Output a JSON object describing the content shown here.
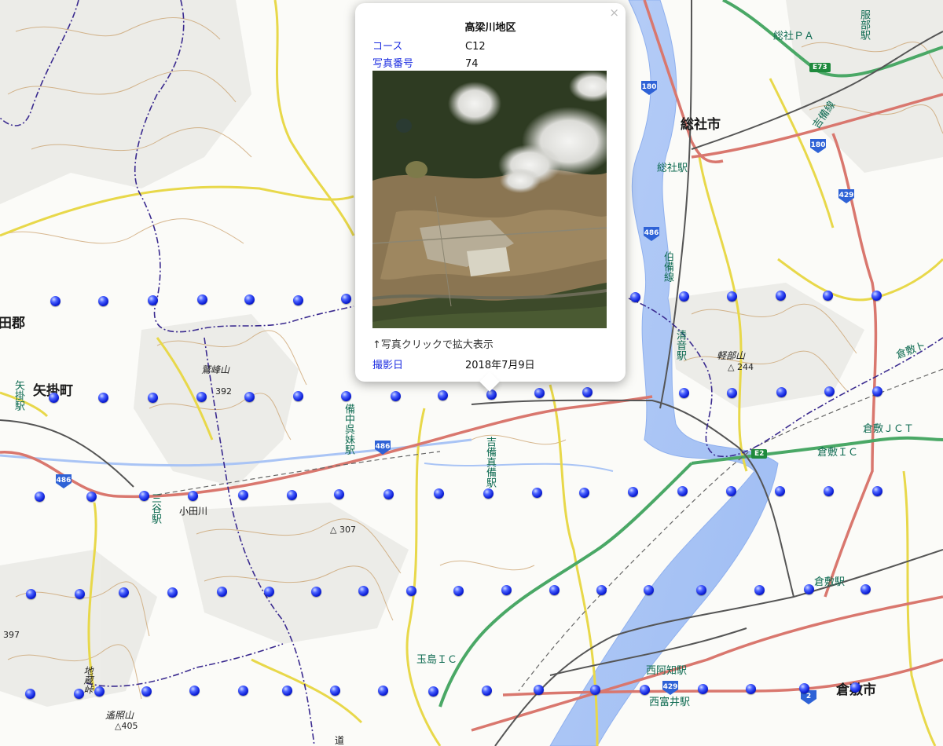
{
  "map": {
    "labels": {
      "sojashi": "総社市",
      "yakagecho": "矢掛町",
      "kurashikishi": "倉敷市",
      "gun": "田郡",
      "soja_station": "総社駅",
      "soja_pa": "総社ＰＡ",
      "hattori_station": "服部駅",
      "kibi_line": "吉備線",
      "hakubi_line": "伯備線",
      "kiyone_station": "清音駅",
      "karube_yama": "軽部山",
      "elev_244": "244",
      "kurashiki_to": "倉敷ト",
      "kurashiki_jct": "倉敷ＪＣＴ",
      "kurashiki_ic": "倉敷ＩＣ",
      "kurashiki_station": "倉敷駅",
      "nishiachi_station": "西阿知駅",
      "nishitomii_station": "西富井駅",
      "tamashima_ic": "玉島ＩＣ",
      "bicchu_kurezuma_station": "備中呉妹駅",
      "kibimakibi_station": "吉備真備駅",
      "sanya_station": "三谷駅",
      "yakage_station": "矢掛駅",
      "washimine_yama": "鷲峰山",
      "elev_392": "392",
      "odagawa": "小田川",
      "elev_307": "307",
      "elev_397": "397",
      "jizo_toge": "地蔵峠",
      "yushozan": "遙照山",
      "elev_405": "405",
      "bottom_partial": "道"
    },
    "shields": {
      "r180_a": "180",
      "r180_b": "180",
      "r486_a": "486",
      "r486_b": "486",
      "r486_c": "486",
      "r429_a": "429",
      "r429_b": "429",
      "r2": "2",
      "e73": "E73",
      "e2": "E2"
    },
    "colors": {
      "marker": "#0d1fd6",
      "national_road": "#d9776e",
      "prefectural_road": "#e8d84a",
      "expressway": "#4aa866",
      "river": "#a9c4f5",
      "contour": "#c79a62",
      "railway": "#555555",
      "boundary": "#3a2a8f"
    }
  },
  "popup": {
    "title": "高梁川地区",
    "course_label": "コース",
    "course_value": "C12",
    "photo_no_label": "写真番号",
    "photo_no_value": "74",
    "hint": "↑写真クリックで拡大表示",
    "date_label": "撮影日",
    "date_value": "2018年7月9日",
    "close_icon": "×"
  }
}
